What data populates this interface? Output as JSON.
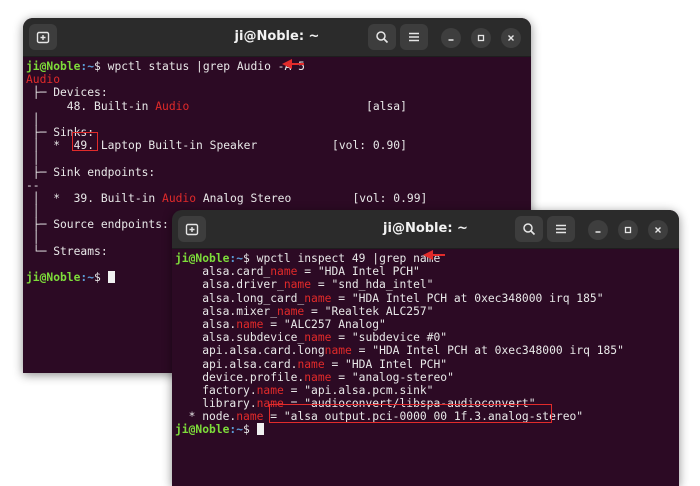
{
  "window1": {
    "title": "ji@Noble: ~",
    "prompt_user": "ji@Noble",
    "prompt_path": ":~",
    "prompt_symbol": "$",
    "command": " wpctl status |grep Audio -A 5",
    "lines": {
      "l0": "Audio",
      "l1": " ├─ Devices:",
      "l2a": "      48. Built-in ",
      "l2b": "Audio",
      "l2c": "                          [alsa]",
      "l4": " ├─ Sinks:",
      "l5a": " │  *  ",
      "l5b": "49.",
      "l5c": " Laptop Built-in Speaker           [vol: 0.90]",
      "l6": " │",
      "l7": " ├─ Sink endpoints:",
      "l8": "--",
      "l9a": " │  *  39. Built-in ",
      "l9b": "Audio",
      "l9c": " Analog Stereo         [vol: 0.99]",
      "l10": " │",
      "l11": " ├─ Source endpoints:",
      "l12": " │",
      "l13": " └─ Streams:"
    }
  },
  "window2": {
    "title": "ji@Noble: ~",
    "prompt_user": "ji@Noble",
    "prompt_path": ":~",
    "prompt_symbol": "$",
    "command": " wpctl inspect 49 |grep name",
    "rows": [
      {
        "pre": "    alsa.card_",
        "hl": "name",
        "post": " = \"HDA Intel PCH\""
      },
      {
        "pre": "    alsa.driver_",
        "hl": "name",
        "post": " = \"snd_hda_intel\""
      },
      {
        "pre": "    alsa.long_card_",
        "hl": "name",
        "post": " = \"HDA Intel PCH at 0xec348000 irq 185\""
      },
      {
        "pre": "    alsa.mixer_",
        "hl": "name",
        "post": " = \"Realtek ALC257\""
      },
      {
        "pre": "    alsa.",
        "hl": "name",
        "post": " = \"ALC257 Analog\""
      },
      {
        "pre": "    alsa.subdevice_",
        "hl": "name",
        "post": " = \"subdevice #0\""
      },
      {
        "pre": "    api.alsa.card.long",
        "hl": "name",
        "post": " = \"HDA Intel PCH at 0xec348000 irq 185\""
      },
      {
        "pre": "    api.alsa.card.",
        "hl": "name",
        "post": " = \"HDA Intel PCH\""
      },
      {
        "pre": "    device.profile.",
        "hl": "name",
        "post": " = \"analog-stereo\""
      },
      {
        "pre": "    factory.",
        "hl": "name",
        "post": " = \"api.alsa.pcm.sink\""
      },
      {
        "pre": "    library.",
        "hl": "name",
        "post": " = \"audioconvert/libspa-audioconvert\""
      },
      {
        "pre": "  * node.",
        "hl": "name",
        "post": " = \"alsa_output.pci-0000_00_1f.3.analog-stereo\""
      }
    ]
  },
  "colors": {
    "terminal_bg": "#2c0a24",
    "prompt_user": "#7ddc3a",
    "prompt_path": "#5b9bd5",
    "match_highlight": "#e02a2a",
    "annotation_red": "#e12b2b"
  },
  "icons": {
    "new_tab": "new-tab-icon",
    "search": "search-icon",
    "menu": "hamburger-menu-icon",
    "minimize": "minimize-icon",
    "maximize": "maximize-icon",
    "close": "close-icon"
  }
}
